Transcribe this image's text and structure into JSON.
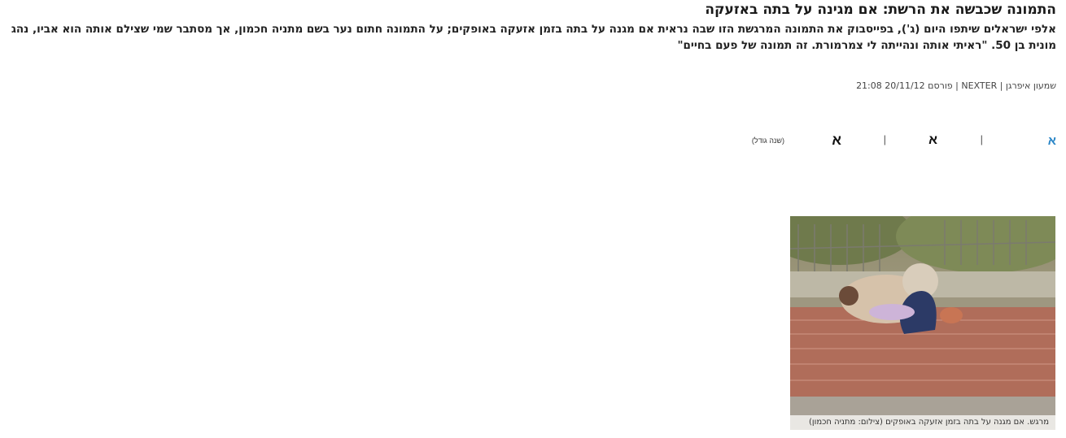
{
  "article": {
    "title": "התמונה שכבשה את הרשת: אם מגינה על בתה באזעקה",
    "lead": "אלפי ישראלים שיתפו היום (ג'), בפייסבוק את התמונה המרגשת הזו שבה נראית אם מגנה על בתה בזמן אזעקה באופקים; על התמונה חתום נער בשם מתניה חכמון, אך מסתבר שמי שצילם אותה הוא אביו, נהג מונית בן 50. \"ראיתי אותה ונהייתה לי צמרמורת. זה תמונה של פעם בחיים\"",
    "byline": "שמעון איפרגן | NEXTER | פורסם 20/11/12 21:08"
  },
  "font_size": {
    "small": "א",
    "separator": "|",
    "medium": "א",
    "large": "א",
    "hint": "(שנה גודל)"
  },
  "photo": {
    "caption": "מרגש. אם מגנה על בתה בזמן אזעקה באופקים (צילום: מתניה חכמון)"
  }
}
